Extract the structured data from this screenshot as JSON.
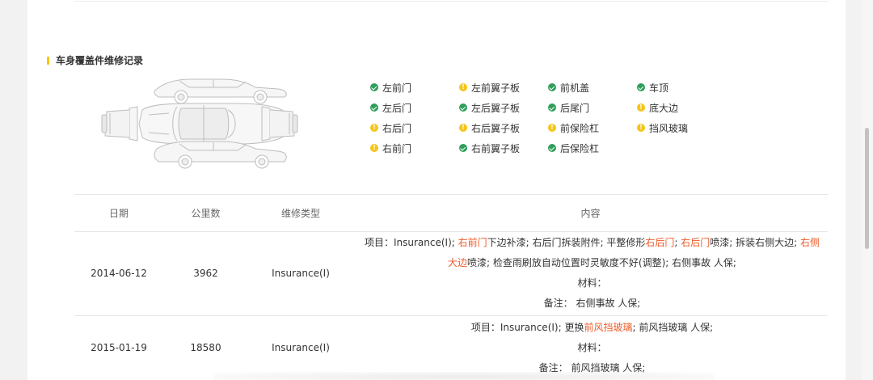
{
  "section": {
    "title": "车身覆盖件维修记录"
  },
  "legend": [
    {
      "label": "左前门",
      "status": "ok"
    },
    {
      "label": "左前翼子板",
      "status": "warn"
    },
    {
      "label": "前机盖",
      "status": "ok"
    },
    {
      "label": "车顶",
      "status": "ok"
    },
    {
      "label": "左后门",
      "status": "ok"
    },
    {
      "label": "左后翼子板",
      "status": "ok"
    },
    {
      "label": "后尾门",
      "status": "ok"
    },
    {
      "label": "底大边",
      "status": "warn"
    },
    {
      "label": "右后门",
      "status": "warn"
    },
    {
      "label": "右后翼子板",
      "status": "warn"
    },
    {
      "label": "前保险杠",
      "status": "warn"
    },
    {
      "label": "挡风玻璃",
      "status": "warn"
    },
    {
      "label": "右前门",
      "status": "warn"
    },
    {
      "label": "右前翼子板",
      "status": "ok"
    },
    {
      "label": "后保险杠",
      "status": "ok"
    }
  ],
  "colors": {
    "ok": "#2e9e5a",
    "warn": "#f5c518",
    "highlight": "#f05a28",
    "accent_bar": "#f7c600"
  },
  "table": {
    "headers": {
      "date": "日期",
      "mileage": "公里数",
      "type": "维修类型",
      "content": "内容"
    },
    "rows": [
      {
        "date": "2014-06-12",
        "mileage": "3962",
        "type": "Insurance(I)",
        "item_prefix": "项目：Insurance(I); ",
        "item_h1": "右前门",
        "item_t1": "下边补漆; 右后门拆装附件; 平整修形",
        "item_h2": "右后门",
        "item_t2": "; ",
        "item_h3": "右后门",
        "item_t3": "喷漆; 拆装右侧大边; ",
        "item_h4": "右侧大边",
        "item_t4": "喷漆; 检查雨刷放自动位置时灵敏度不好(调整); 右侧事故 人保;",
        "material": "材料：",
        "note": "备注： 右侧事故 人保;"
      },
      {
        "date": "2015-01-19",
        "mileage": "18580",
        "type": "Insurance(I)",
        "item_prefix": "项目：Insurance(I); 更换",
        "item_h1": "前风挡玻璃",
        "item_t1": "; 前风挡玻璃 人保;",
        "material": "材料：",
        "note": "备注： 前风挡玻璃 人保;"
      }
    ]
  }
}
